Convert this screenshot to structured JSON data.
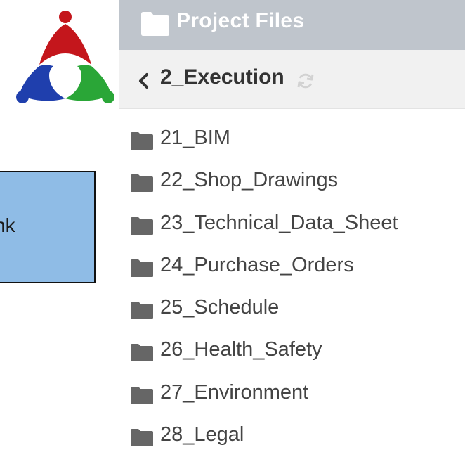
{
  "logo": {
    "colors": {
      "top": "#c4161c",
      "left": "#1f3fad",
      "right": "#2aa637"
    }
  },
  "note": {
    "visible_text": "nk",
    "background": "#8fbce6"
  },
  "panel": {
    "header_title": "Project Files",
    "header_background": "#bfc5cc",
    "header_icon": "folder-icon",
    "breadcrumb_text": "2_Execution",
    "back_icon": "chevron-left-icon",
    "refresh_icon": "refresh-icon",
    "folders": [
      {
        "label": "21_BIM"
      },
      {
        "label": "22_Shop_Drawings"
      },
      {
        "label": "23_Technical_Data_Sheet"
      },
      {
        "label": "24_Purchase_Orders"
      },
      {
        "label": "25_Schedule"
      },
      {
        "label": "26_Health_Safety"
      },
      {
        "label": "27_Environment"
      },
      {
        "label": "28_Legal"
      }
    ]
  }
}
